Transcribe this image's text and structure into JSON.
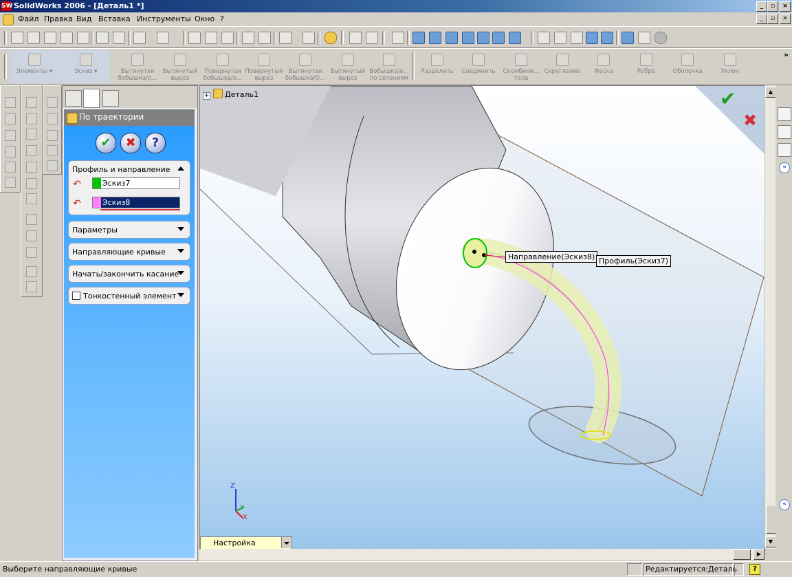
{
  "window": {
    "title": "SolidWorks 2006 - [Деталь1 *]",
    "logo_text": "SW",
    "controls": [
      "_",
      "▫",
      "×"
    ],
    "mdi_controls": [
      "_",
      "▫",
      "×"
    ]
  },
  "menu": [
    "Файл",
    "Правка",
    "Вид",
    "Вставка",
    "Инструменты",
    "Окно",
    "?"
  ],
  "feature_toolbar": {
    "items": [
      {
        "label": "Элементы"
      },
      {
        "label": "Эскиз"
      },
      {
        "label": "Вытянутая бобышка/о..."
      },
      {
        "label": "Вытянутый вырез"
      },
      {
        "label": "Повернутая бобышка/о..."
      },
      {
        "label": "Повернутый вырез"
      },
      {
        "label": "Вытянутая бобышка/О..."
      },
      {
        "label": "Вытянутый вырез"
      },
      {
        "label": "Бобышка/о... по сечениям"
      },
      {
        "label": "Разделить"
      },
      {
        "label": "Соединить"
      },
      {
        "label": "Скомбини... тела"
      },
      {
        "label": "Скругление"
      },
      {
        "label": "Фаска"
      },
      {
        "label": "Ребро"
      },
      {
        "label": "Оболочка"
      },
      {
        "label": "Уклон"
      }
    ],
    "overflow": "»"
  },
  "property_manager": {
    "title": "По траектории",
    "buttons": {
      "ok": "✔",
      "cancel": "✖",
      "help": "?"
    },
    "groups": {
      "profile": {
        "title": "Профиль и направление",
        "profile_value": "Эскиз7",
        "profile_color": "#00c800",
        "path_value": "Эскиз8",
        "path_color": "#ff80ff"
      },
      "params": "Параметры",
      "guides": "Направляющие кривые",
      "tangency": "Начать/закончить касание",
      "thin": "Тонкостенный элемент"
    }
  },
  "tree": {
    "root": "Деталь1",
    "expander": "+"
  },
  "callouts": {
    "direction": "Направление(Эскиз8)",
    "profile": "Профиль(Эскиз7)"
  },
  "confirm_corner": {
    "ok": "✔",
    "cancel": "✖"
  },
  "triad": {
    "z": "Z",
    "y": "Y",
    "x": "X"
  },
  "configuration": {
    "value": "Настройка"
  },
  "taskpane": {
    "collapse": "«"
  },
  "scroll_glyphs": {
    "up": "▲",
    "down": "▼",
    "left": "◀",
    "right": "▶"
  },
  "status": {
    "message": "Выберите направляющие кривые",
    "mode": "Редактируется:Деталь",
    "help": "?"
  },
  "colors": {
    "accent": "#0a246a",
    "path": "#ff40ff",
    "profile": "#00c000"
  }
}
